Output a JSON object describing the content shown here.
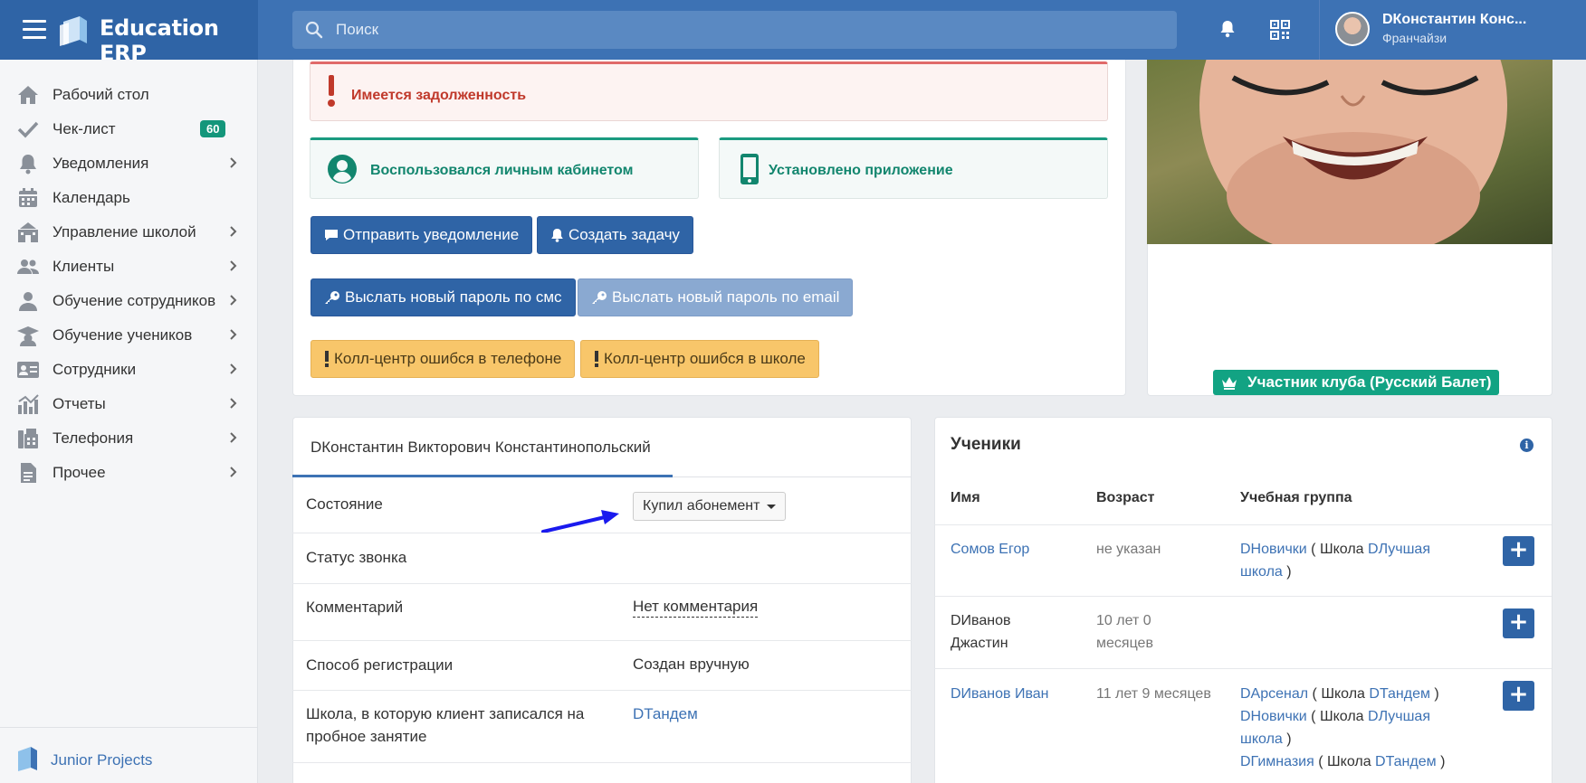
{
  "app": {
    "title": "Education ERP"
  },
  "search": {
    "placeholder": "Поиск"
  },
  "user": {
    "name": "DКонстантин Конс...",
    "role": "Франчайзи"
  },
  "sidebar": {
    "items": [
      {
        "label": "Рабочий стол",
        "icon": "home-icon"
      },
      {
        "label": "Чек-лист",
        "icon": "check-icon",
        "badge": "60"
      },
      {
        "label": "Уведомления",
        "icon": "bell-icon"
      },
      {
        "label": "Календарь",
        "icon": "calendar-icon"
      },
      {
        "label": "Управление школой",
        "icon": "school-icon"
      },
      {
        "label": "Клиенты",
        "icon": "users-icon"
      },
      {
        "label": "Обучение сотрудников",
        "icon": "user-training-icon"
      },
      {
        "label": "Обучение учеников",
        "icon": "graduation-cap-icon"
      },
      {
        "label": "Сотрудники",
        "icon": "id-card-icon"
      },
      {
        "label": "Отчеты",
        "icon": "chart-icon"
      },
      {
        "label": "Телефония",
        "icon": "fax-icon"
      },
      {
        "label": "Прочее",
        "icon": "file-icon"
      }
    ],
    "footer": "Junior Projects"
  },
  "alerts": {
    "debt": "Имеется задолженность",
    "cabinet": "Воспользовался личным кабинетом",
    "app_installed": "Установлено приложение"
  },
  "actions": {
    "send_notification": "Отправить уведомление",
    "create_task": "Создать задачу",
    "send_sms_password": "Выслать новый пароль по смс",
    "send_email_password": "Выслать новый пароль по email",
    "callcenter_phone_error": "Колл-центр ошибся в телефоне",
    "callcenter_school_error": "Колл-центр ошибся в школе"
  },
  "club_badge": "Участник клуба (Русский Балет)",
  "client": {
    "tab": "DКонстантин Викторович Константинопольский",
    "fields": [
      {
        "label": "Состояние",
        "value": "Купил абонемент"
      },
      {
        "label": "Статус звонка",
        "value": ""
      },
      {
        "label": "Комментарий",
        "value": "Нет комментария"
      },
      {
        "label": "Способ регистрации",
        "value": "Создан вручную"
      },
      {
        "label": "Школа, в которую клиент записался на пробное занятие",
        "value": "DТандем"
      }
    ]
  },
  "students": {
    "title": "Ученики",
    "headers": [
      "Имя",
      "Возраст",
      "Учебная группа"
    ],
    "rows": [
      {
        "name": "Сомов Егор",
        "age": "не указан",
        "groups": [
          {
            "group": "DНовички",
            "pre": " ( Школа ",
            "school": "DЛучшая школа",
            "post": " )"
          }
        ]
      },
      {
        "name": "DИванов Джастин",
        "age": "10 лет 0 месяцев",
        "groups": []
      },
      {
        "name": "DИванов Иван",
        "age": "11 лет 9 месяцев",
        "groups": [
          {
            "group": "DАрсенал",
            "pre": " ( Школа ",
            "school": "DТандем",
            "post": " )"
          },
          {
            "group": "DНовички",
            "pre": " ( Школа ",
            "school": "DЛучшая школа",
            "post": " )"
          },
          {
            "group": "DГимназия",
            "pre": " ( Школа ",
            "school": "DТандем",
            "post": " )"
          }
        ]
      }
    ]
  },
  "colors": {
    "topbar": "#3d72b4",
    "brand": "#2f64a6",
    "primary_button": "#2f64a6",
    "warning_button": "#f8c66a",
    "success": "#12a383",
    "danger": "#c0392b",
    "annotation_arrow": "#1a1aee"
  }
}
